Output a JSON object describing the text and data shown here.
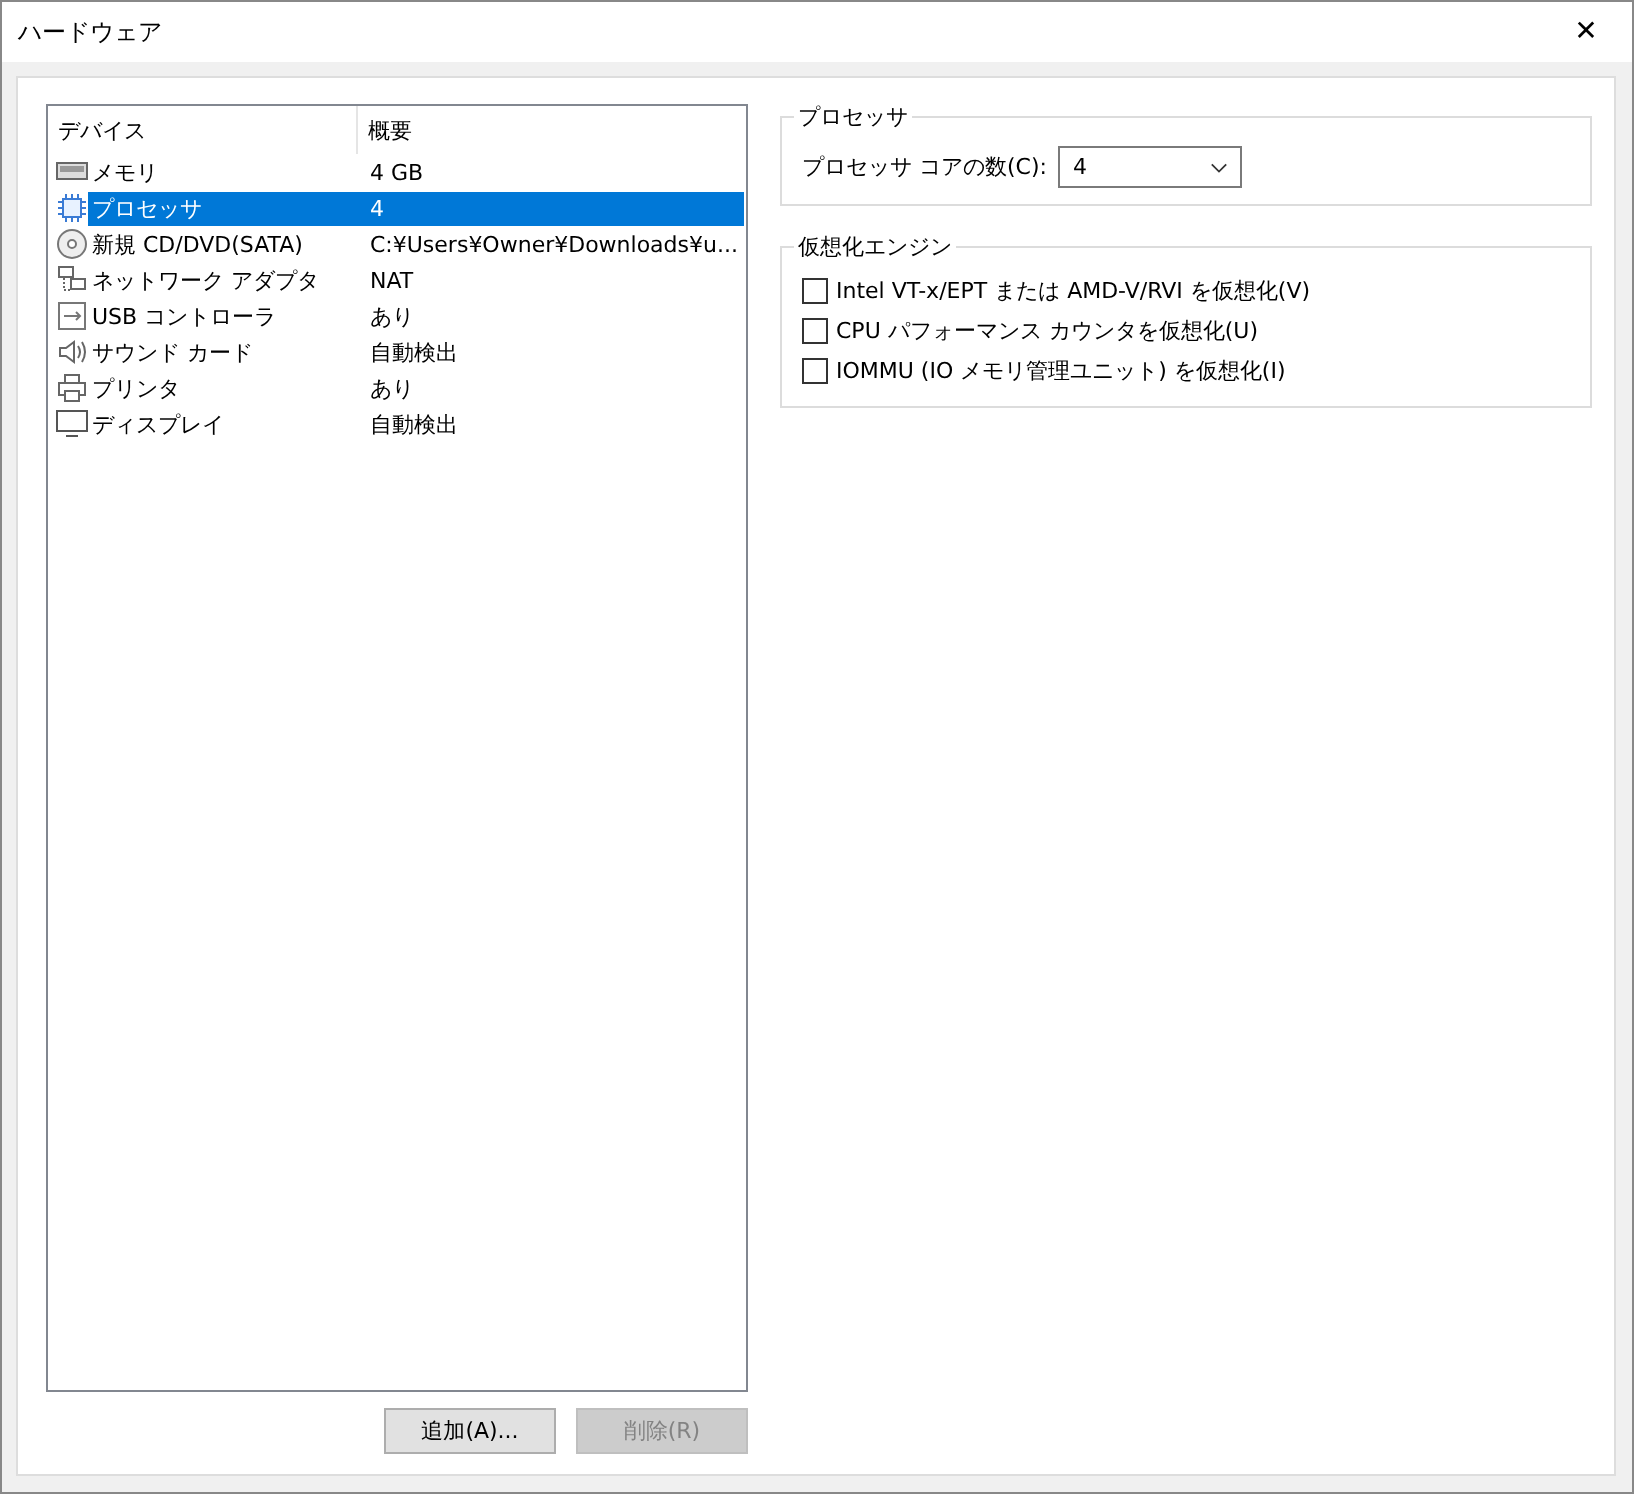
{
  "window": {
    "title": "ハードウェア",
    "close": "✕"
  },
  "device_table": {
    "columns": [
      "デバイス",
      "概要"
    ],
    "rows": [
      {
        "kind": "memory",
        "device": "メモリ",
        "summary": "4 GB",
        "selected": false
      },
      {
        "kind": "processor",
        "device": "プロセッサ",
        "summary": "4",
        "selected": true
      },
      {
        "kind": "disc",
        "device": "新規 CD/DVD(SATA)",
        "summary": "C:¥Users¥Owner¥Downloads¥u...",
        "selected": false
      },
      {
        "kind": "network",
        "device": "ネットワーク アダプタ",
        "summary": "NAT",
        "selected": false
      },
      {
        "kind": "usb",
        "device": "USB コントローラ",
        "summary": "あり",
        "selected": false
      },
      {
        "kind": "sound",
        "device": "サウンド カード",
        "summary": "自動検出",
        "selected": false
      },
      {
        "kind": "printer",
        "device": "プリンタ",
        "summary": "あり",
        "selected": false
      },
      {
        "kind": "display",
        "device": "ディスプレイ",
        "summary": "自動検出",
        "selected": false
      }
    ]
  },
  "buttons": [
    {
      "label": "追加(A)...",
      "disabled": false
    },
    {
      "label": "削除(R)",
      "disabled": true
    }
  ],
  "processor_group": {
    "title": "プロセッサ",
    "cores_label": "プロセッサ コアの数(C):",
    "cores_value": "4"
  },
  "virtualization_group": {
    "title": "仮想化エンジン",
    "options": [
      {
        "label": "Intel VT-x/EPT または AMD-V/RVI を仮想化(V)",
        "checked": false
      },
      {
        "label": "CPU パフォーマンス カウンタを仮想化(U)",
        "checked": false
      },
      {
        "label": "IOMMU (IO メモリ管理ユニット) を仮想化(I)",
        "checked": false
      }
    ]
  }
}
